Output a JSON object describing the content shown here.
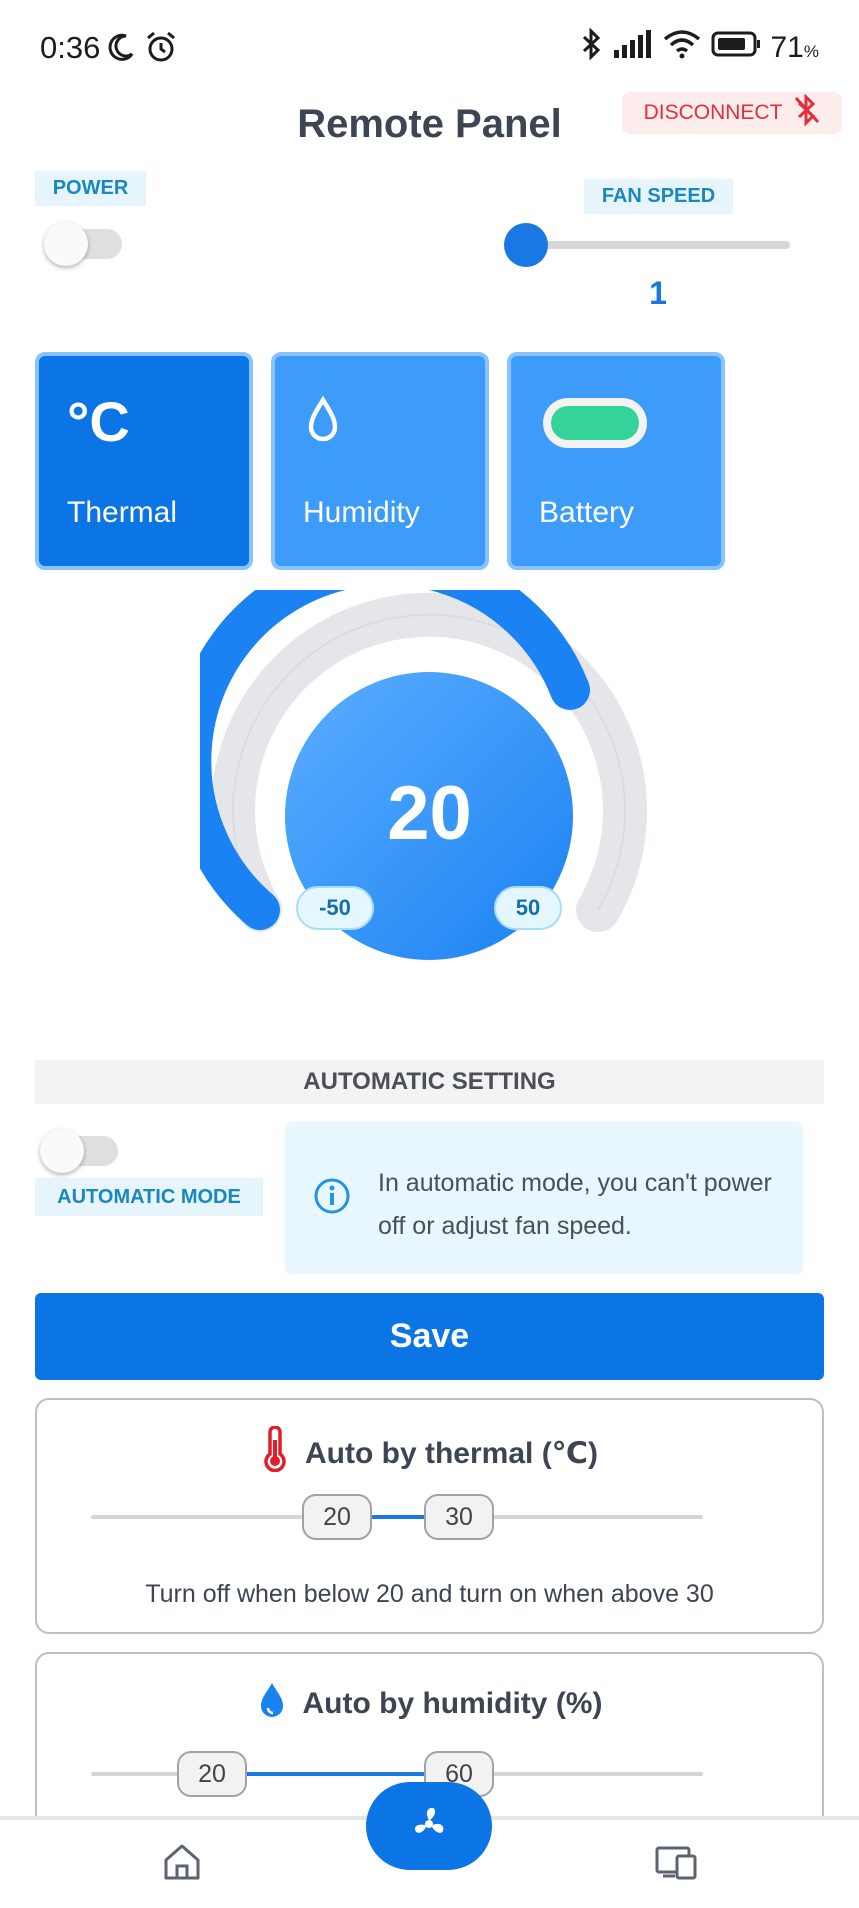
{
  "status_bar": {
    "time": "0:36",
    "battery": "71",
    "battery_unit": "%"
  },
  "header": {
    "title": "Remote Panel",
    "disconnect_label": "DISCONNECT"
  },
  "controls": {
    "power_label": "POWER",
    "power_on": false,
    "fan_speed_label": "FAN SPEED",
    "fan_speed_value": "1"
  },
  "modes": [
    {
      "label": "Thermal",
      "icon": "celsius-icon",
      "active": true
    },
    {
      "label": "Humidity",
      "icon": "water-drop-icon",
      "active": false
    },
    {
      "label": "Battery",
      "icon": "battery-icon",
      "active": false
    }
  ],
  "gauge": {
    "value": "20",
    "min": "-50",
    "max": "50"
  },
  "automatic": {
    "section_title": "AUTOMATIC SETTING",
    "mode_label": "AUTOMATIC MODE",
    "mode_on": false,
    "info_text": "In automatic mode, you can't power off or adjust fan speed.",
    "save_label": "Save"
  },
  "auto_thermal": {
    "title": "Auto by thermal (℃)",
    "low": "20",
    "high": "30",
    "description": "Turn off when below 20 and turn on when above 30"
  },
  "auto_humidity": {
    "title": "Auto by humidity (%)",
    "low": "20",
    "high": "60"
  },
  "bottom_nav": {
    "items": [
      "home-icon",
      "fan-icon",
      "devices-icon"
    ]
  },
  "colors": {
    "primary": "#0b75e6",
    "accent_light": "#3d9bfa",
    "danger": "#e0303b",
    "tag_bg": "#e6f4fb"
  }
}
